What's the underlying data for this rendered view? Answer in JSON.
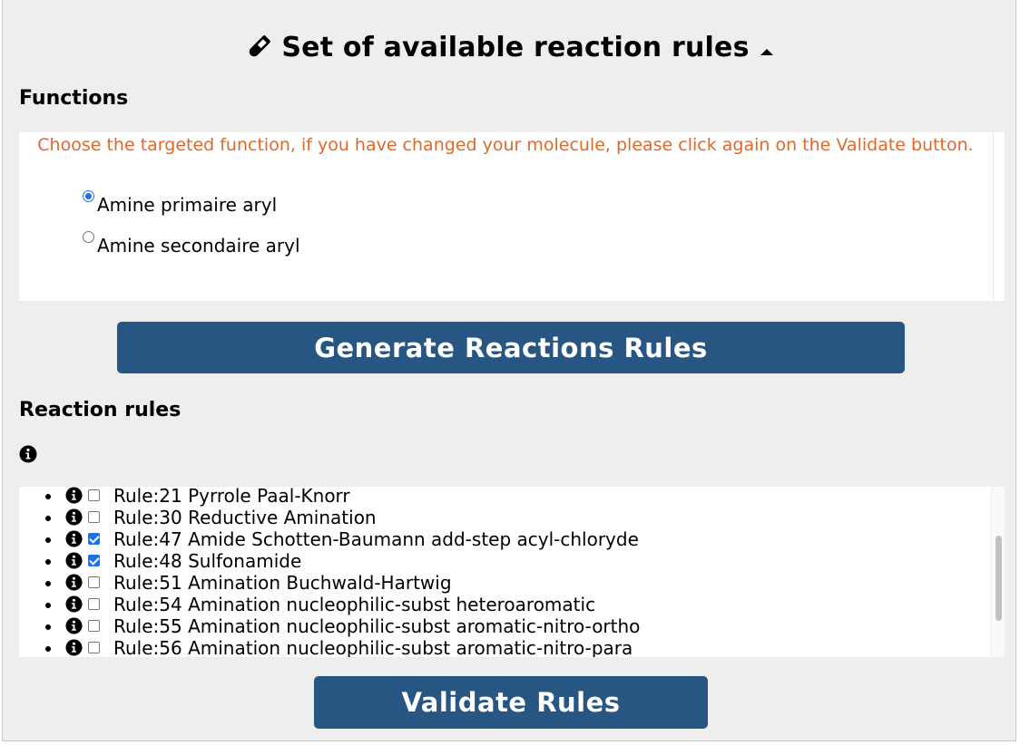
{
  "header": {
    "title": "Set of available reaction rules",
    "title_icon": "vial-icon",
    "caret_icon": "caret-up-icon"
  },
  "functions": {
    "heading": "Functions",
    "notice": "Choose the targeted function, if you have changed your molecule, please click again on the Validate button.",
    "options": [
      {
        "label": "Amine primaire aryl",
        "checked": true
      },
      {
        "label": "Amine secondaire aryl",
        "checked": false
      }
    ]
  },
  "generate_button": {
    "label": "Generate Reactions Rules"
  },
  "reaction_rules": {
    "heading": "Reaction rules",
    "info_icon": "info-circle-icon",
    "rules": [
      {
        "label": "Rule:21 Pyrrole Paal-Knorr",
        "checked": false
      },
      {
        "label": "Rule:30 Reductive Amination",
        "checked": false
      },
      {
        "label": "Rule:47 Amide Schotten-Baumann add-step acyl-chloryde",
        "checked": true
      },
      {
        "label": "Rule:48 Sulfonamide",
        "checked": true
      },
      {
        "label": "Rule:51 Amination Buchwald-Hartwig",
        "checked": false
      },
      {
        "label": "Rule:54 Amination nucleophilic-subst heteroaromatic",
        "checked": false
      },
      {
        "label": "Rule:55 Amination nucleophilic-subst aromatic-nitro-ortho",
        "checked": false
      },
      {
        "label": "Rule:56 Amination nucleophilic-subst aromatic-nitro-para",
        "checked": false
      }
    ]
  },
  "validate_button": {
    "label": "Validate Rules"
  },
  "colors": {
    "panel_bg": "#eeeeee",
    "button_bg": "#285682",
    "notice_text": "#e0692a",
    "accent": "#1a73e8"
  }
}
